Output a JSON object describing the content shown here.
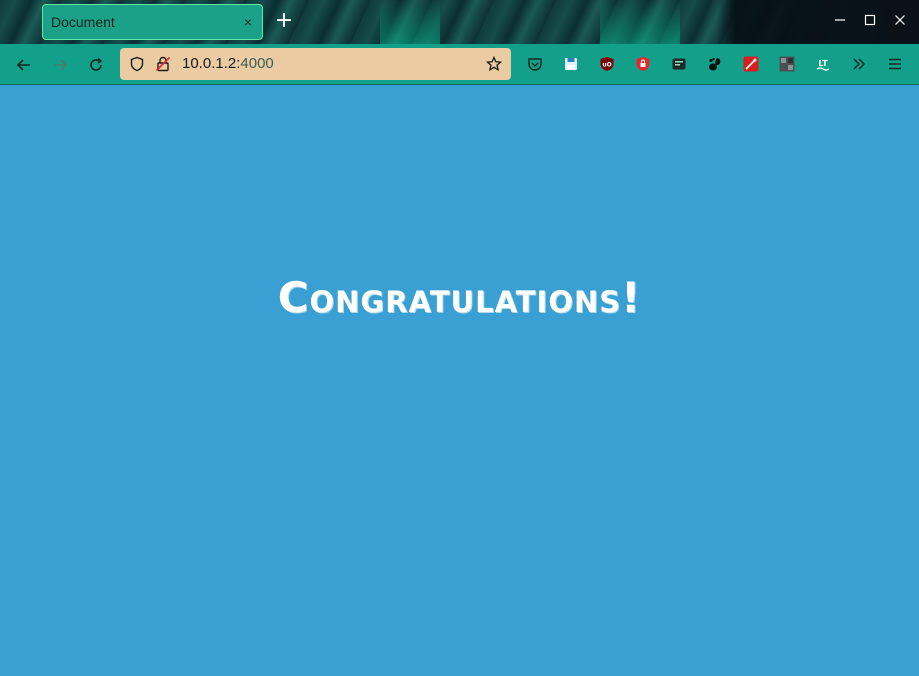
{
  "tab": {
    "title": "Document",
    "close_glyph": "×"
  },
  "new_tab_glyph": "+",
  "window_controls": {
    "minimize": "—",
    "maximize": "☐",
    "close": "✕"
  },
  "urlbar": {
    "host": "10.0.1.2:",
    "port": "4000"
  },
  "page": {
    "headline": "Congratulations!"
  },
  "colors": {
    "page_background": "#3aa0d3",
    "toolbar": "#12a08a",
    "tab": "#1ba187",
    "urlbar": "#ebcba2",
    "headline": "#ffffff"
  },
  "toolbar_icons": [
    "back-arrow-icon",
    "forward-arrow-icon",
    "reload-icon",
    "shield-icon",
    "insecure-lock-icon",
    "bookmark-star-icon",
    "pocket-icon",
    "save-icon",
    "ublock-icon",
    "red-lock-extension-icon",
    "reader-extension-icon",
    "gnome-extension-icon",
    "wand-extension-icon",
    "grid-extension-icon",
    "languagetool-icon",
    "overflow-chevrons-icon",
    "menu-hamburger-icon"
  ]
}
